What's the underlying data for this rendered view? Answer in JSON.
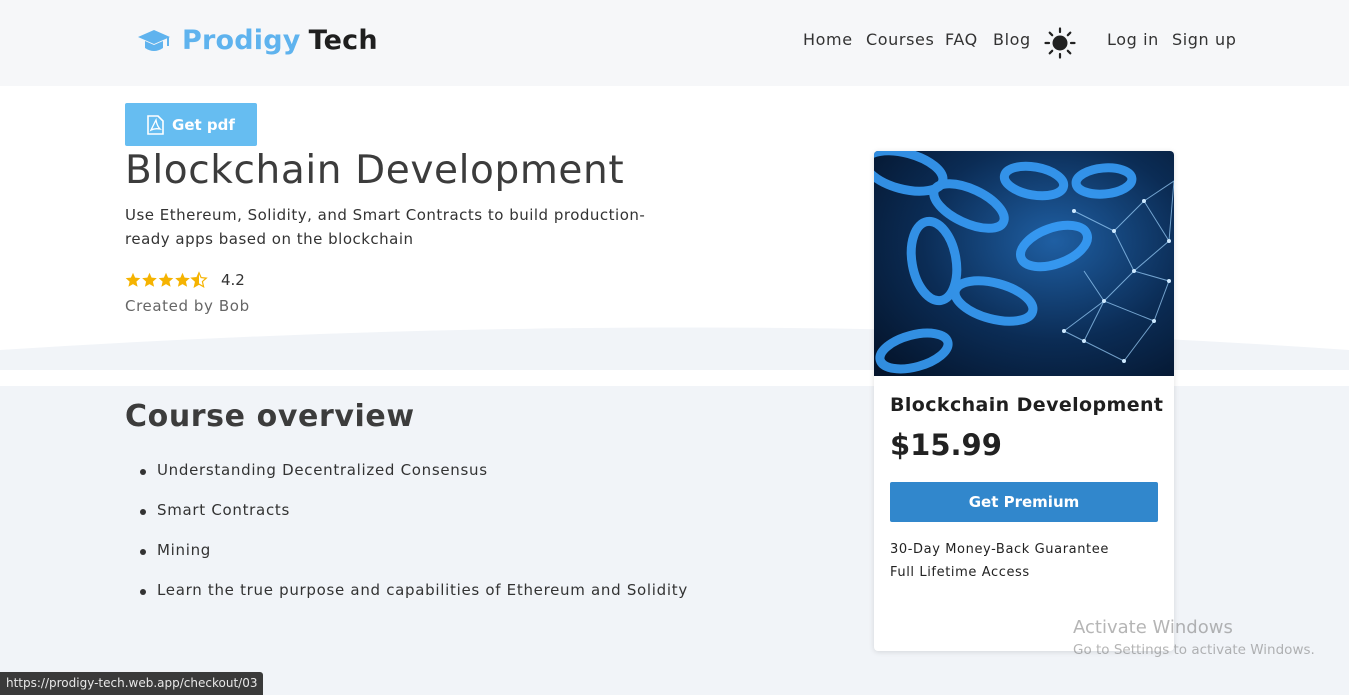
{
  "brand": {
    "name_part1": "Prodigy",
    "name_part2": "Tech",
    "logo_icon": "graduation-cap-icon",
    "accent_color": "#5fb3ee"
  },
  "nav": {
    "items": [
      "Home",
      "Courses",
      "FAQ",
      "Blog"
    ],
    "theme_icon": "sun-icon",
    "login": "Log in",
    "signup": "Sign up"
  },
  "course": {
    "pdf_button": "Get pdf",
    "pdf_icon": "pdf-icon",
    "title": "Blockchain Development",
    "description": "Use Ethereum, Solidity, and Smart Contracts to build production-ready apps based on the blockchain",
    "rating": "4.2",
    "rating_value": 4.2,
    "rating_max": 5,
    "created_by": "Created by Bob"
  },
  "overview": {
    "title": "Course overview",
    "items": [
      "Understanding Decentralized Consensus",
      "Smart Contracts",
      "Mining",
      "Learn the true purpose and capabilities of Ethereum and Solidity"
    ]
  },
  "card": {
    "title": "Blockchain Development",
    "price": "$15.99",
    "button": "Get Premium",
    "button_color": "#3187cc",
    "features": [
      "30-Day Money-Back Guarantee",
      "Full Lifetime Access"
    ]
  },
  "os_overlay": {
    "activate_title": "Activate Windows",
    "activate_sub": "Go to Settings to activate Windows."
  },
  "status_bar": {
    "url": "https://prodigy-tech.web.app/checkout/03"
  }
}
